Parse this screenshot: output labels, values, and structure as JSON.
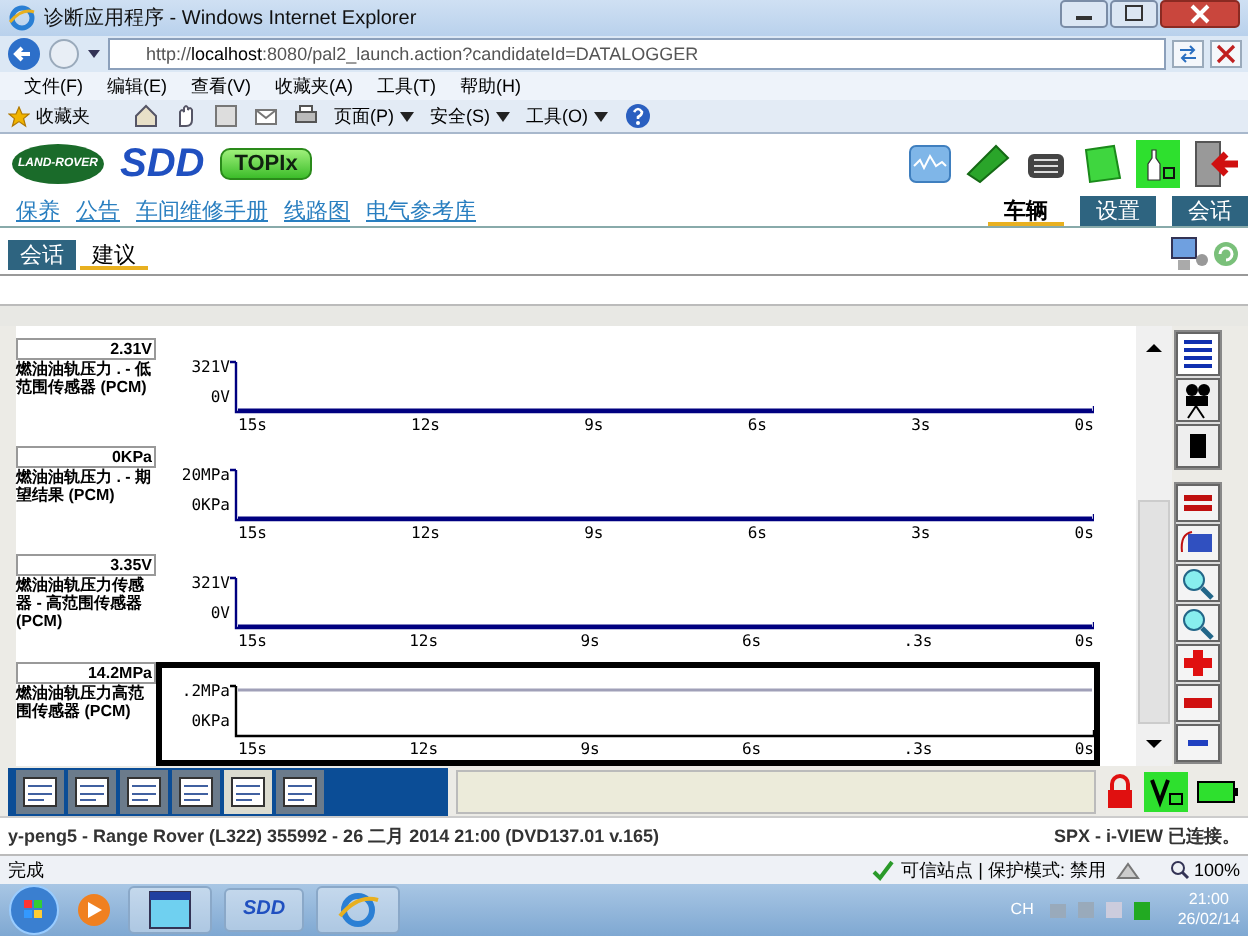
{
  "window": {
    "title": "诊断应用程序 - Windows Internet Explorer"
  },
  "address_bar": {
    "url": "http://**localhost**:8080/pal2_launch.action?candidateId=DATALOGGER"
  },
  "menu": [
    "文件(F)",
    "编辑(E)",
    "查看(V)",
    "收藏夹(A)",
    "工具(T)",
    "帮助(H)"
  ],
  "command_bar": {
    "favorites": "收藏夹",
    "items": [
      "页面(P)",
      "安全(S)",
      "工具(O)"
    ]
  },
  "app": {
    "logo": "LAND-ROVER",
    "brand": "SDD",
    "topix": "TOPIx"
  },
  "links": [
    "保养",
    "公告",
    "车间维修手册",
    "线路图",
    "电气参考库"
  ],
  "main_tabs": [
    {
      "label": "车辆",
      "selected": true
    },
    {
      "label": "设置",
      "selected": false
    },
    {
      "label": "会话",
      "selected": false
    }
  ],
  "sub_tabs": [
    {
      "label": "会话",
      "selected": false
    },
    {
      "label": "建议",
      "selected": true
    }
  ],
  "charts": [
    {
      "value": "2.31V",
      "label": "燃油油轨压力 . - 低范围传感器 (PCM)",
      "selected": false,
      "trace_high": false,
      "y_labels": [
        "321V",
        "0V"
      ],
      "x_labels": [
        "15s",
        "12s",
        "9s",
        "6s",
        "3s",
        "0s"
      ]
    },
    {
      "value": "0KPa",
      "label": "燃油油轨压力 . - 期望结果 (PCM)",
      "selected": false,
      "trace_high": false,
      "y_labels": [
        "20MPa",
        "0KPa"
      ],
      "x_labels": [
        "15s",
        "12s",
        "9s",
        "6s",
        "3s",
        "0s"
      ]
    },
    {
      "value": "3.35V",
      "label": "燃油油轨压力传感器 - 高范围传感器 (PCM)",
      "selected": false,
      "trace_high": false,
      "y_labels": [
        "321V",
        "0V"
      ],
      "x_labels": [
        "15s",
        "12s",
        "9s",
        "6s",
        ".3s",
        "0s"
      ]
    },
    {
      "value": "14.2MPa",
      "label": "燃油油轨压力高范围传感器 (PCM)",
      "selected": true,
      "trace_high": true,
      "y_labels": [
        ".2MPa",
        "0KPa"
      ],
      "x_labels": [
        "15s",
        "12s",
        "9s",
        "6s",
        ".3s",
        "0s"
      ]
    }
  ],
  "bottom_tabs": [
    {
      "selected": false
    },
    {
      "selected": false
    },
    {
      "selected": false
    },
    {
      "selected": false
    },
    {
      "selected": true
    },
    {
      "selected": false
    }
  ],
  "status": {
    "session": "y-peng5 - Range Rover (L322) 355992 - 26 二月 2014 21:00 (DVD137.01 v.165)",
    "connection": "SPX - i-VIEW 已连接。"
  },
  "ie_status": {
    "text": "完成",
    "zone": "可信站点 | 保护模式: 禁用",
    "zoom": "100%"
  },
  "taskbar": {
    "task": "SDD",
    "language": "CH",
    "time": "21:00",
    "date": "26/02/14"
  }
}
